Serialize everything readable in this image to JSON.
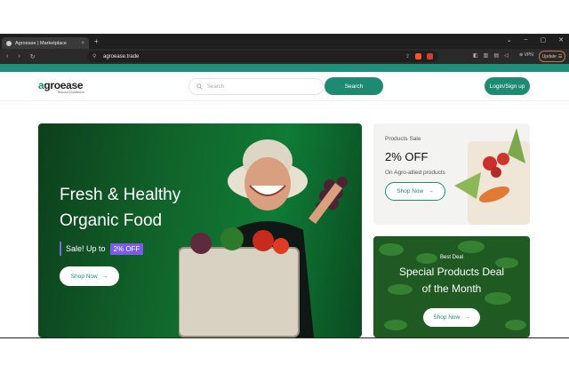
{
  "browser": {
    "tab_title": "Agroease | Marketplace",
    "tab_close": "×",
    "new_tab": "+",
    "url": "agroease.trade",
    "vpn_label": "VPN",
    "update_label": "Update",
    "window_controls": [
      "⌄",
      "–",
      "▢",
      "✕"
    ]
  },
  "site": {
    "logo_prefix": "a",
    "logo_rest": "groease",
    "tagline": "Beyond Excellence",
    "search_placeholder": "Search",
    "search_button": "Search",
    "login_button": "Login/Sign up",
    "accent_color": "#1f8a72"
  },
  "hero": {
    "line1": "Fresh & Healthy",
    "line2": "Organic Food",
    "sale_text": "Sale! Up to",
    "sale_badge": "2% OFF",
    "button": "Shop Now"
  },
  "card_sale": {
    "label": "Products Sale",
    "headline": "2% OFF",
    "subtext": "On Agro-allied products",
    "button": "Shop Now"
  },
  "card_deal": {
    "label": "Best Deal",
    "line1": "Special Products Deal",
    "line2": "of the Month",
    "button": "Shop Now"
  }
}
